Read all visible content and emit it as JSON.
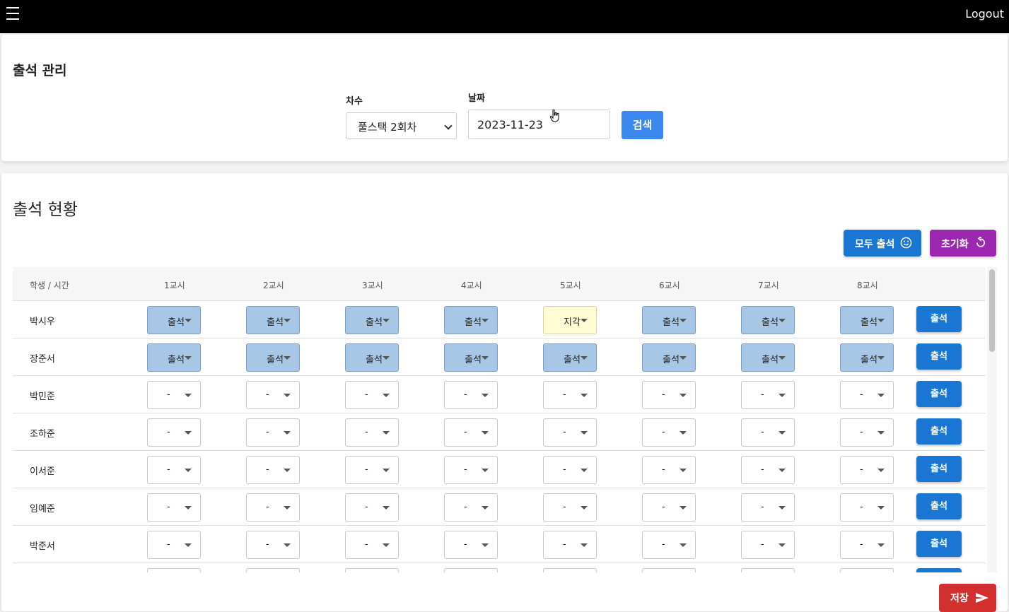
{
  "topbar": {
    "logout_label": "Logout",
    "menu_icon": "hamburger-icon"
  },
  "manage": {
    "title": "출석 관리",
    "round_label": "차수",
    "round_value": "풀스택 2회차",
    "date_label": "날짜",
    "date_value": "2023-11-23",
    "search_label": "검색"
  },
  "status": {
    "title": "출석 현황",
    "all_present_label": "모두 출석",
    "reset_label": "초기화",
    "save_label": "저장",
    "colors": {
      "present_bg": "#a8c6e6",
      "late_bg": "#fffcd6",
      "primary": "#1976d2",
      "purple": "#9c27b0",
      "red": "#d32f2f"
    }
  },
  "table": {
    "headers": [
      "학생 / 시간",
      "1교시",
      "2교시",
      "3교시",
      "4교시",
      "5교시",
      "6교시",
      "7교시",
      "8교시"
    ],
    "row_button_label": "출석",
    "rows": [
      {
        "name": "박시우",
        "cells": [
          "출석",
          "출석",
          "출석",
          "출석",
          "지각",
          "출석",
          "출석",
          "출석"
        ]
      },
      {
        "name": "장준서",
        "cells": [
          "출석",
          "출석",
          "출석",
          "출석",
          "출석",
          "출석",
          "출석",
          "출석"
        ]
      },
      {
        "name": "박민준",
        "cells": [
          "-",
          "-",
          "-",
          "-",
          "-",
          "-",
          "-",
          "-"
        ]
      },
      {
        "name": "조하준",
        "cells": [
          "-",
          "-",
          "-",
          "-",
          "-",
          "-",
          "-",
          "-"
        ]
      },
      {
        "name": "이서준",
        "cells": [
          "-",
          "-",
          "-",
          "-",
          "-",
          "-",
          "-",
          "-"
        ]
      },
      {
        "name": "임예준",
        "cells": [
          "-",
          "-",
          "-",
          "-",
          "-",
          "-",
          "-",
          "-"
        ]
      },
      {
        "name": "박준서",
        "cells": [
          "-",
          "-",
          "-",
          "-",
          "-",
          "-",
          "-",
          "-"
        ]
      },
      {
        "name": "",
        "cells": [
          "-",
          "-",
          "-",
          "-",
          "-",
          "-",
          "-",
          "-"
        ]
      }
    ]
  }
}
